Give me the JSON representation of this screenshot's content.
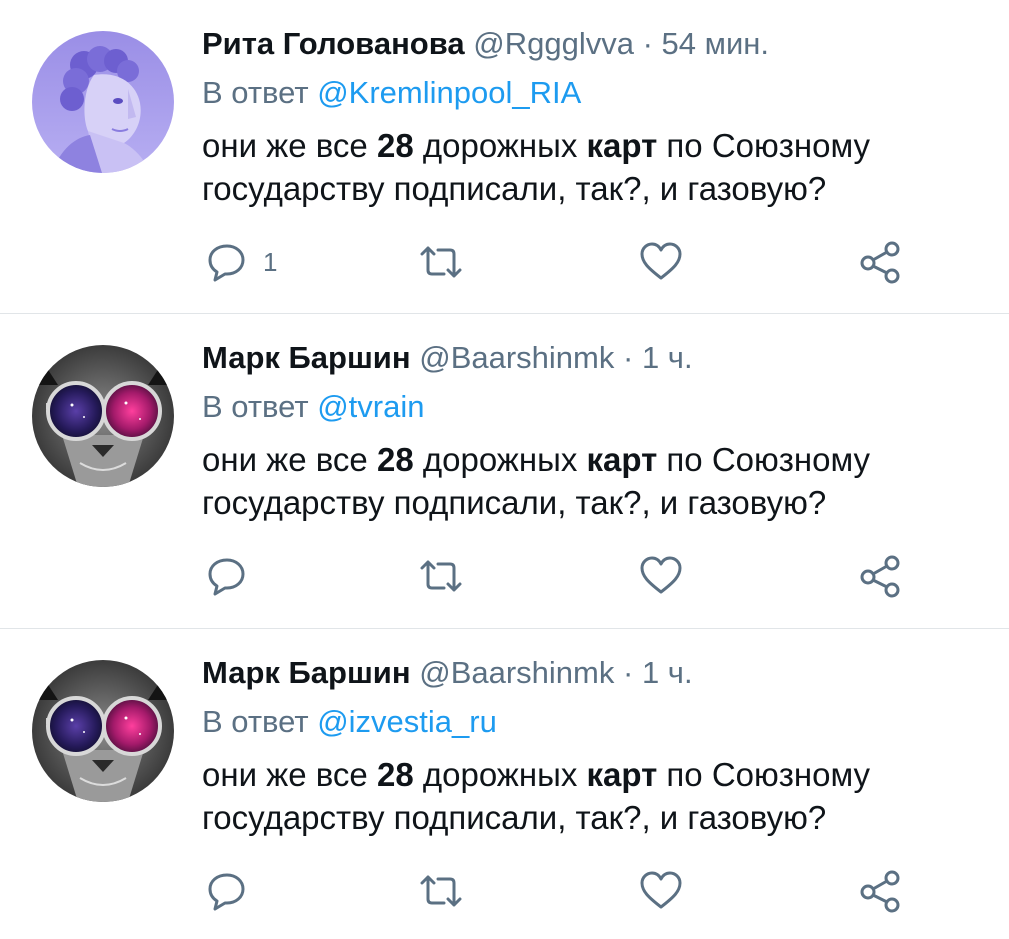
{
  "tweets": [
    {
      "name": "Рита Голованова",
      "handle": "@Rggglvva",
      "separator": "·",
      "time": "54 мин.",
      "reply_prefix": "В ответ",
      "reply_to": "@Kremlinpool_RIA",
      "text_1": "они же  все ",
      "bold_1": "28",
      "text_2": " дорожных ",
      "bold_2": "карт",
      "text_3": " по Союзному государству подписали, так?,  и газовую?",
      "reply_count": "1",
      "avatar": "statue-avatar"
    },
    {
      "name": "Марк Баршин",
      "handle": "@Baarshinmk",
      "separator": "·",
      "time": "1 ч.",
      "reply_prefix": "В ответ",
      "reply_to": "@tvrain",
      "text_1": "они же  все ",
      "bold_1": "28",
      "text_2": " дорожных ",
      "bold_2": "карт",
      "text_3": " по Союзному государству подписали, так?,  и газовую?",
      "reply_count": "",
      "avatar": "cat-with-glasses-avatar"
    },
    {
      "name": "Марк Баршин",
      "handle": "@Baarshinmk",
      "separator": "·",
      "time": "1 ч.",
      "reply_prefix": "В ответ",
      "reply_to": "@izvestia_ru",
      "text_1": "они же  все ",
      "bold_1": "28",
      "text_2": " дорожных ",
      "bold_2": "карт",
      "text_3": " по Союзному государству подписали, так?,  и газовую?",
      "reply_count": "",
      "avatar": "cat-with-glasses-avatar"
    }
  ],
  "icons": {
    "reply": "reply-icon",
    "retweet": "retweet-icon",
    "like": "like-icon",
    "share": "share-icon"
  },
  "colors": {
    "text": "#0f1419",
    "secondary": "#5b7083",
    "link": "#1d9bf0",
    "divider": "#e1e5e8"
  }
}
